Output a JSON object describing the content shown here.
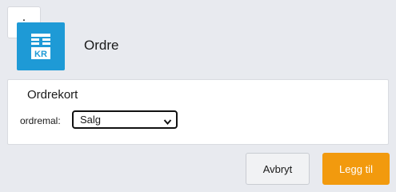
{
  "header": {
    "menu_label": ".",
    "title": "Ordre",
    "app_icon": {
      "name": "order-list-icon",
      "text": "KR",
      "color": "#1e9ad6"
    }
  },
  "card": {
    "title": "Ordrekort",
    "field_label": "ordremal:",
    "select_value": "Salg"
  },
  "actions": {
    "cancel_label": "Avbryt",
    "add_label": "Legg til",
    "add_color": "#f29a0e"
  }
}
